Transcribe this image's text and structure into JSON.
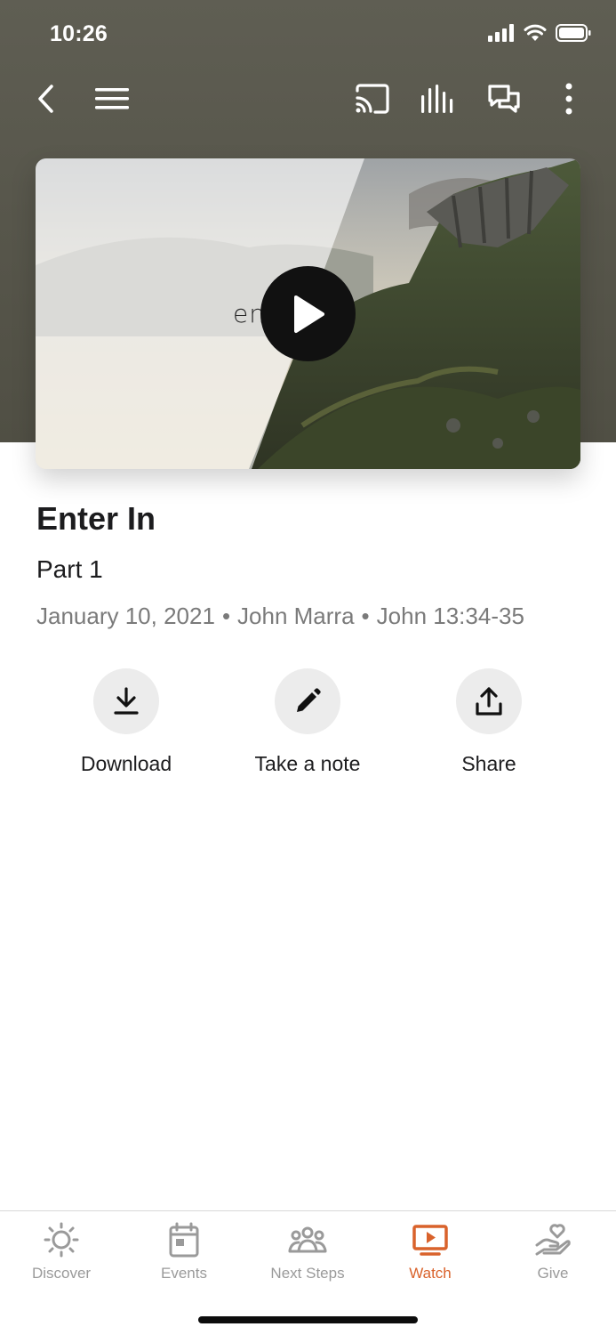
{
  "status": {
    "time": "10:26"
  },
  "media": {
    "overlay_text": "enter",
    "title": "Enter In",
    "subtitle": "Part 1",
    "date": "January 10, 2021",
    "speaker": "John Marra",
    "scripture": "John 13:34-35",
    "separator": "•"
  },
  "actions": [
    {
      "label": "Download",
      "icon": "download-icon"
    },
    {
      "label": "Take a note",
      "icon": "pencil-icon"
    },
    {
      "label": "Share",
      "icon": "share-icon"
    }
  ],
  "tabs": [
    {
      "label": "Discover",
      "icon": "sun-icon"
    },
    {
      "label": "Events",
      "icon": "calendar-icon"
    },
    {
      "label": "Next Steps",
      "icon": "people-icon"
    },
    {
      "label": "Watch",
      "icon": "tv-play-icon",
      "active": true
    },
    {
      "label": "Give",
      "icon": "hand-heart-icon"
    }
  ],
  "colors": {
    "accent": "#d9622b",
    "header": "#57564b",
    "inactive": "#9a9a9a"
  }
}
